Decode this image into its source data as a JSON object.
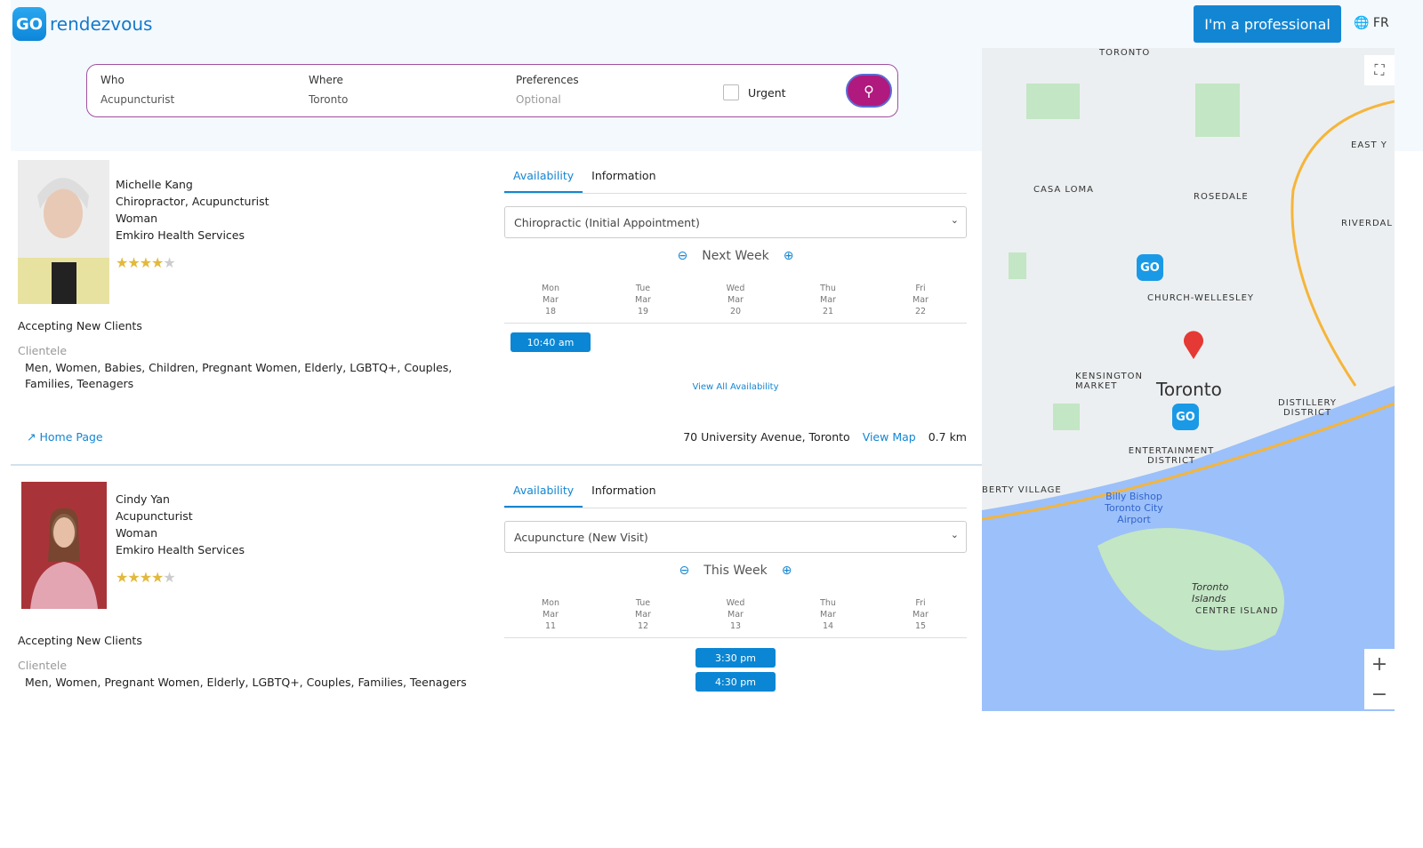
{
  "header": {
    "logo_badge": "GO",
    "logo_text": "rendezvous",
    "pro_button": "I'm a professional",
    "lang": "FR"
  },
  "search": {
    "who_label": "Who",
    "who_value": "Acupuncturist",
    "where_label": "Where",
    "where_value": "Toronto",
    "pref_label": "Preferences",
    "pref_placeholder": "Optional",
    "urgent_label": "Urgent"
  },
  "results": [
    {
      "name": "Michelle Kang",
      "profession": "Chiropractor, Acupuncturist",
      "gender": "Woman",
      "clinic": "Emkiro Health Services",
      "rating": 4.5,
      "accepting": "Accepting New Clients",
      "clientele_label": "Clientele",
      "clientele": "Men, Women, Babies, Children, Pregnant Women, Elderly, LGBTQ+, Couples, Families, Teenagers",
      "tabs": [
        "Availability",
        "Information"
      ],
      "service": "Chiropractic (Initial Appointment)",
      "week": "Next Week",
      "days": [
        [
          "Mon",
          "Mar",
          "18"
        ],
        [
          "Tue",
          "Mar",
          "19"
        ],
        [
          "Wed",
          "Mar",
          "20"
        ],
        [
          "Thu",
          "Mar",
          "21"
        ],
        [
          "Fri",
          "Mar",
          "22"
        ]
      ],
      "slots": [
        "10:40 am"
      ],
      "view_all": "View All Availability",
      "home_page": "Home Page",
      "address": "70 University Avenue, Toronto",
      "view_map": "View Map",
      "distance": "0.7 km"
    },
    {
      "name": "Cindy Yan",
      "profession": "Acupuncturist",
      "gender": "Woman",
      "clinic": "Emkiro Health Services",
      "rating": 4.5,
      "accepting": "Accepting New Clients",
      "clientele_label": "Clientele",
      "clientele": "Men, Women, Pregnant Women, Elderly, LGBTQ+, Couples, Families, Teenagers",
      "tabs": [
        "Availability",
        "Information"
      ],
      "service": "Acupuncture (New Visit)",
      "week": "This Week",
      "days": [
        [
          "Mon",
          "Mar",
          "11"
        ],
        [
          "Tue",
          "Mar",
          "12"
        ],
        [
          "Wed",
          "Mar",
          "13"
        ],
        [
          "Thu",
          "Mar",
          "14"
        ],
        [
          "Fri",
          "Mar",
          "15"
        ]
      ],
      "slots": [
        "3:30 pm",
        "4:30 pm"
      ]
    }
  ],
  "map": {
    "labels": [
      "TORONTO",
      "CASA LOMA",
      "ROSEDALE",
      "CHURCH-WELLESLEY",
      "KENSINGTON MARKET",
      "Toronto",
      "ENTERTAINMENT DISTRICT",
      "DISTILLERY DISTRICT",
      "BERTY VILLAGE",
      "Billy Bishop Toronto City Airport",
      "Toronto Islands",
      "CENTRE ISLAND",
      "RIVERDAL",
      "EAST Y"
    ],
    "zoom_in": "+",
    "zoom_out": "−",
    "colors": {
      "water": "#9cc0f9",
      "park": "#c3e6c4",
      "land": "#eceff1"
    }
  }
}
